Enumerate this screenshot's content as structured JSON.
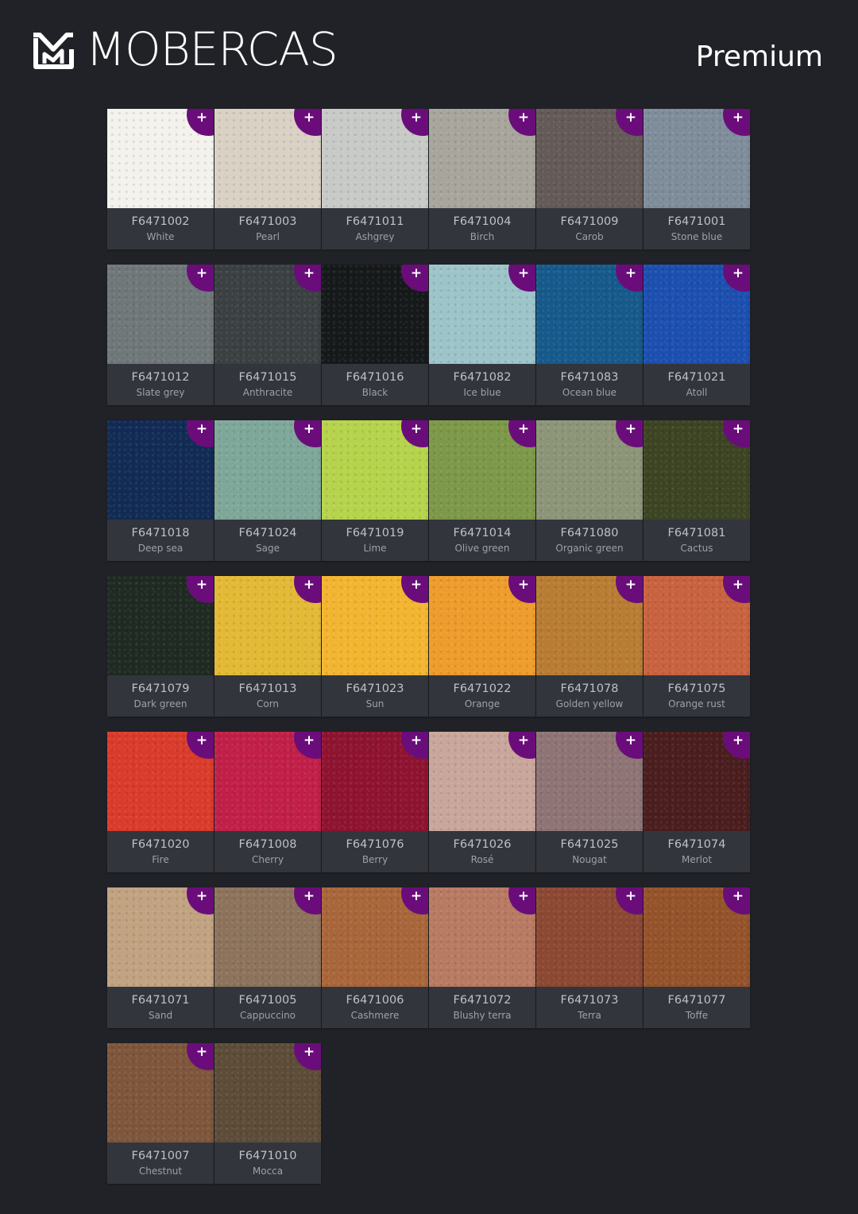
{
  "header": {
    "brand": "MOBERCAS",
    "logo_icon": "mobercas-logo-mark",
    "collection": "Premium"
  },
  "add_icon": "plus-icon",
  "accent_color": "#6a0d7a",
  "swatches": [
    {
      "code": "F6471002",
      "name": "White",
      "color": "#f4f2ec"
    },
    {
      "code": "F6471003",
      "name": "Pearl",
      "color": "#d9d1c4"
    },
    {
      "code": "F6471011",
      "name": "Ashgrey",
      "color": "#c7cac6"
    },
    {
      "code": "F6471004",
      "name": "Birch",
      "color": "#a8a59c"
    },
    {
      "code": "F6471009",
      "name": "Carob",
      "color": "#645a57"
    },
    {
      "code": "F6471001",
      "name": "Stone blue",
      "color": "#7f8d9b"
    },
    {
      "code": "F6471012",
      "name": "Slate grey",
      "color": "#6f7779"
    },
    {
      "code": "F6471015",
      "name": "Anthracite",
      "color": "#3b4042"
    },
    {
      "code": "F6471016",
      "name": "Black",
      "color": "#15191a"
    },
    {
      "code": "F6471082",
      "name": "Ice blue",
      "color": "#9cc4c9"
    },
    {
      "code": "F6471083",
      "name": "Ocean blue",
      "color": "#165a8c"
    },
    {
      "code": "F6471021",
      "name": "Atoll",
      "color": "#1c4fb0"
    },
    {
      "code": "F6471018",
      "name": "Deep sea",
      "color": "#122b55"
    },
    {
      "code": "F6471024",
      "name": "Sage",
      "color": "#7ea79a"
    },
    {
      "code": "F6471019",
      "name": "Lime",
      "color": "#b6d34c"
    },
    {
      "code": "F6471014",
      "name": "Olive green",
      "color": "#7c9848"
    },
    {
      "code": "F6471080",
      "name": "Organic green",
      "color": "#8d9578"
    },
    {
      "code": "F6471081",
      "name": "Cactus",
      "color": "#3c4423"
    },
    {
      "code": "F6471079",
      "name": "Dark green",
      "color": "#1f2a22"
    },
    {
      "code": "F6471013",
      "name": "Corn",
      "color": "#e3b935"
    },
    {
      "code": "F6471023",
      "name": "Sun",
      "color": "#f3b530"
    },
    {
      "code": "F6471022",
      "name": "Orange",
      "color": "#ee9c2b"
    },
    {
      "code": "F6471078",
      "name": "Golden yellow",
      "color": "#b97c33"
    },
    {
      "code": "F6471075",
      "name": "Orange rust",
      "color": "#c8623f"
    },
    {
      "code": "F6471020",
      "name": "Fire",
      "color": "#da3b2b"
    },
    {
      "code": "F6471008",
      "name": "Cherry",
      "color": "#c21f48"
    },
    {
      "code": "F6471076",
      "name": "Berry",
      "color": "#8f1330"
    },
    {
      "code": "F6471026",
      "name": "Rosé",
      "color": "#c9a69c"
    },
    {
      "code": "F6471025",
      "name": "Nougat",
      "color": "#8e7475"
    },
    {
      "code": "F6471074",
      "name": "Merlot",
      "color": "#4a1d1e"
    },
    {
      "code": "F6471071",
      "name": "Sand",
      "color": "#c1a281"
    },
    {
      "code": "F6471005",
      "name": "Cappuccino",
      "color": "#8d735b"
    },
    {
      "code": "F6471006",
      "name": "Cashmere",
      "color": "#a9663a"
    },
    {
      "code": "F6471072",
      "name": "Blushy terra",
      "color": "#b87a62"
    },
    {
      "code": "F6471073",
      "name": "Terra",
      "color": "#8c4832"
    },
    {
      "code": "F6471077",
      "name": "Toffe",
      "color": "#94532a"
    },
    {
      "code": "F6471007",
      "name": "Chestnut",
      "color": "#7e563b"
    },
    {
      "code": "F6471010",
      "name": "Mocca",
      "color": "#5c4c38"
    }
  ]
}
